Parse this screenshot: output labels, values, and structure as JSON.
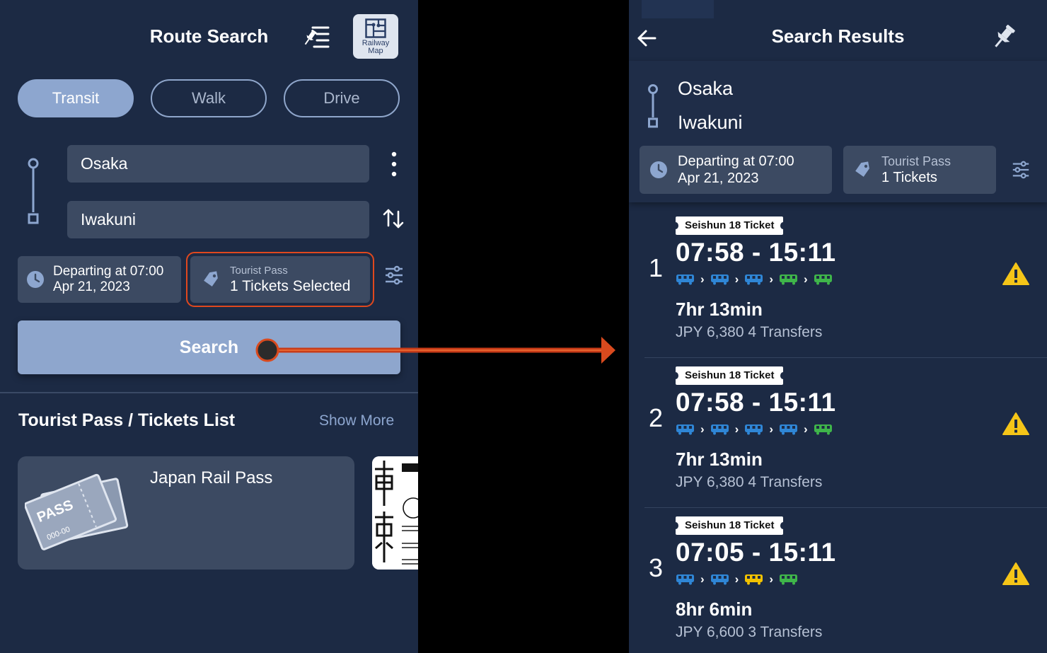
{
  "left": {
    "title": "Route Search",
    "railway_map": {
      "line1": "Railway",
      "line2": "Map"
    },
    "modes": [
      "Transit",
      "Walk",
      "Drive"
    ],
    "active_mode": "Transit",
    "from": "Osaka",
    "to": "Iwakuni",
    "departure": {
      "line1": "Departing at 07:00",
      "line2": "Apr 21, 2023"
    },
    "pass": {
      "label": "Tourist Pass",
      "value": "1 Tickets Selected"
    },
    "search_label": "Search",
    "tickets_section": {
      "title": "Tourist Pass / Tickets List",
      "show_more": "Show More"
    },
    "pass_cards": [
      {
        "title": "Japan Rail Pass",
        "icon": "pass-ticket-icon",
        "icon_text": "PASS",
        "icon_serial": "000-00"
      }
    ]
  },
  "right": {
    "title": "Search Results",
    "from": "Osaka",
    "to": "Iwakuni",
    "departure": {
      "line1": "Departing at 07:00",
      "line2": "Apr 21, 2023"
    },
    "pass": {
      "label": "Tourist Pass",
      "value": "1 Tickets"
    },
    "results": [
      {
        "num": "1",
        "badge": "Seishun 18 Ticket",
        "time": "07:58 - 15:11",
        "trains": [
          "blue",
          "blue",
          "blue",
          "green",
          "green"
        ],
        "duration": "7hr 13min",
        "fare": "JPY 6,380 4 Transfers"
      },
      {
        "num": "2",
        "badge": "Seishun 18 Ticket",
        "time": "07:58 - 15:11",
        "trains": [
          "blue",
          "blue",
          "blue",
          "blue",
          "green"
        ],
        "duration": "7hr 13min",
        "fare": "JPY 6,380 4 Transfers"
      },
      {
        "num": "3",
        "badge": "Seishun 18 Ticket",
        "time": "07:05 - 15:11",
        "trains": [
          "blue",
          "blue",
          "yellow",
          "green"
        ],
        "duration": "8hr 6min",
        "fare": "JPY 6,600 3 Transfers"
      }
    ]
  },
  "colors": {
    "panel_bg": "#1c2a44",
    "accent": "#8da6cf",
    "highlight": "#e0481e",
    "warning": "#f5c518",
    "train_blue": "#2f86d6",
    "train_green": "#3fb54a",
    "train_yellow": "#f2c200"
  }
}
